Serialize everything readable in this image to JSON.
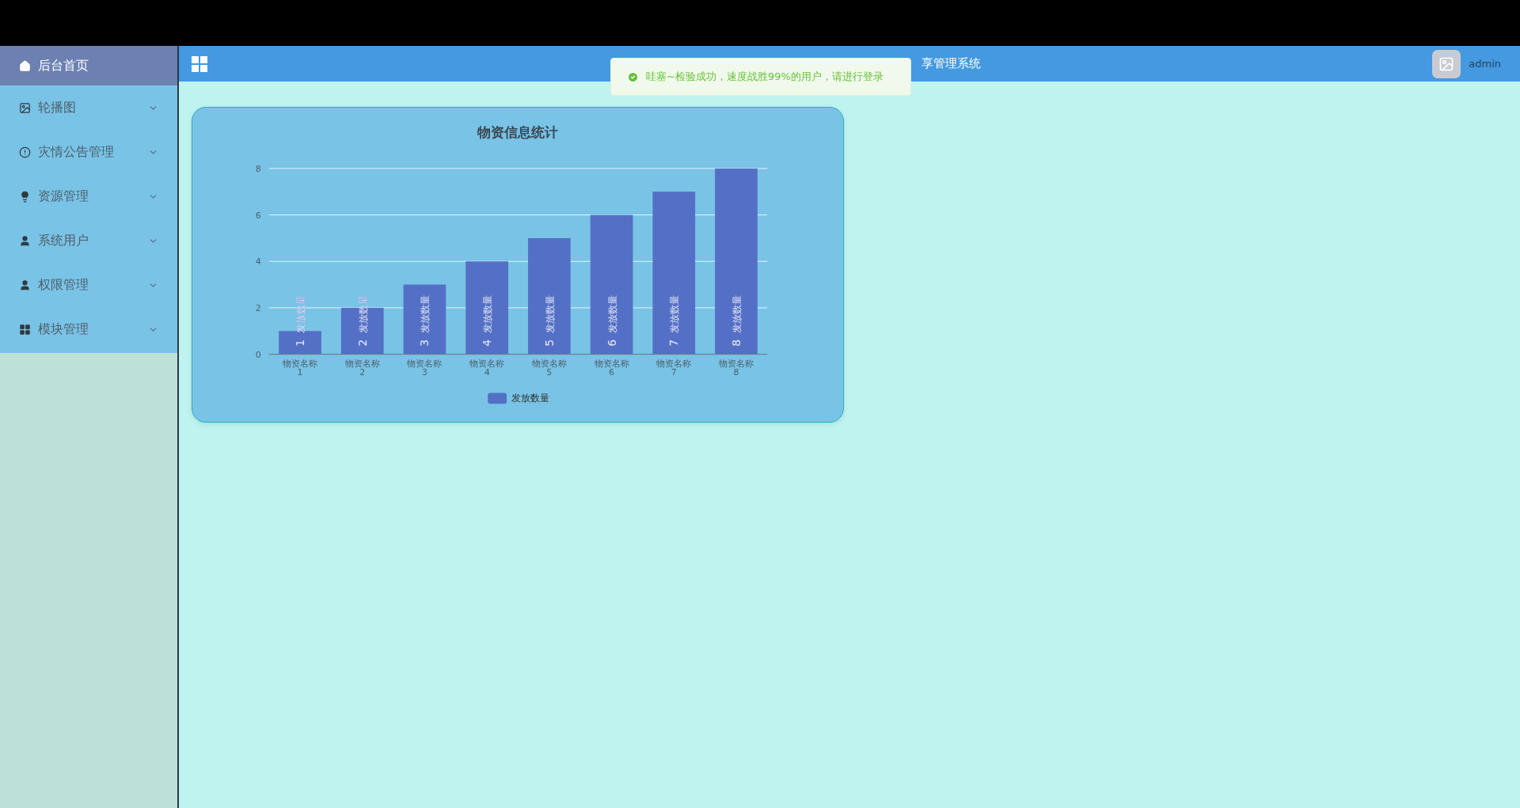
{
  "sidebar": {
    "items": [
      {
        "label": "后台首页",
        "kind": "link",
        "selected": true
      },
      {
        "label": "轮播图",
        "kind": "submenu",
        "selected": false
      },
      {
        "label": "灾情公告管理",
        "kind": "submenu",
        "selected": false
      },
      {
        "label": "资源管理",
        "kind": "submenu",
        "selected": false
      },
      {
        "label": "系统用户",
        "kind": "submenu",
        "selected": false
      },
      {
        "label": "权限管理",
        "kind": "submenu",
        "selected": false
      },
      {
        "label": "模块管理",
        "kind": "submenu",
        "selected": false
      }
    ]
  },
  "header": {
    "title": "享管理系统",
    "user": "admin"
  },
  "toast": {
    "kind": "success",
    "message": "哇塞~检验成功，速度战胜99%的用户，请进行登录"
  },
  "chart_card": {
    "chart_data": {
      "type": "bar",
      "title": "物资信息统计",
      "categories": [
        "物资名称1",
        "物资名称2",
        "物资名称3",
        "物资名称4",
        "物资名称5",
        "物资名称6",
        "物资名称7",
        "物资名称8"
      ],
      "series": [
        {
          "name": "发放数量",
          "color": "#5470c6",
          "values": [
            1,
            2,
            3,
            4,
            5,
            6,
            7,
            8
          ]
        }
      ],
      "ylim": [
        0,
        8
      ],
      "grid": true,
      "yticks": [
        0,
        2,
        4,
        6,
        8
      ],
      "data_labels": true
    }
  }
}
